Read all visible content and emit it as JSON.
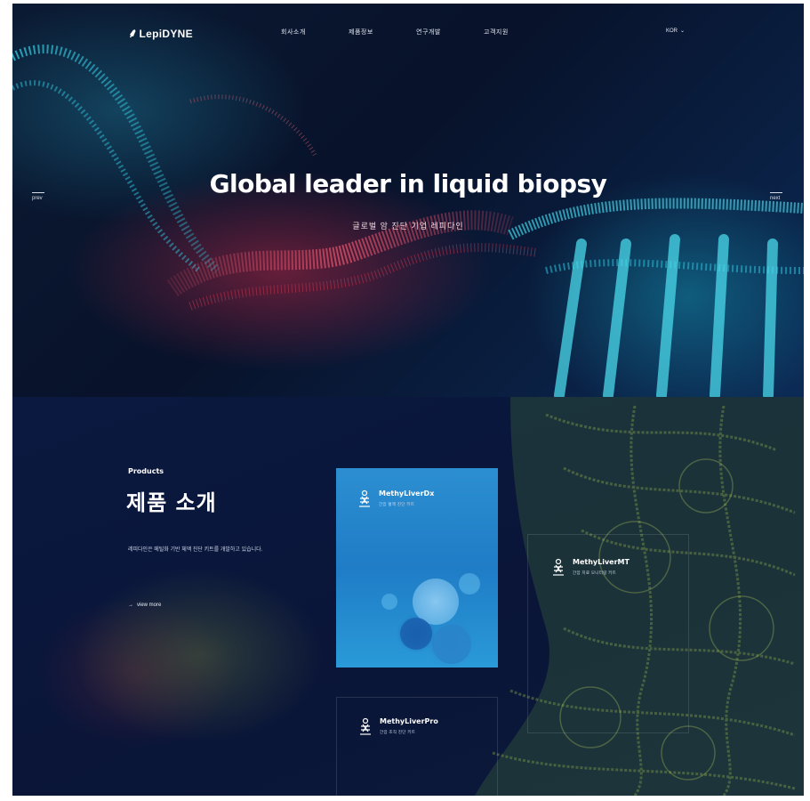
{
  "header": {
    "logo": "LepiDYNE",
    "menu": [
      "회사소개",
      "제품정보",
      "연구개발",
      "고객지원"
    ],
    "language": "KOR"
  },
  "hero": {
    "title": "Global leader in liquid biopsy",
    "subtitle": "글로벌 암 진단 기업 레피다인",
    "prev_label": "prev",
    "next_label": "next"
  },
  "products": {
    "label": "Products",
    "title": "제품 소개",
    "description": "레피다인은 메틸화 기반 체액 진단 키트를 개발하고 있습니다.",
    "view_more": "view more",
    "items": [
      {
        "name": "MethyLiverDx",
        "subtitle": "간암 혈액 진단 키트"
      },
      {
        "name": "MethyLiverMT",
        "subtitle": "간암 치료 모니터링 키트"
      },
      {
        "name": "MethyLiverPro",
        "subtitle": "간암 조직 진단 키트"
      }
    ]
  }
}
